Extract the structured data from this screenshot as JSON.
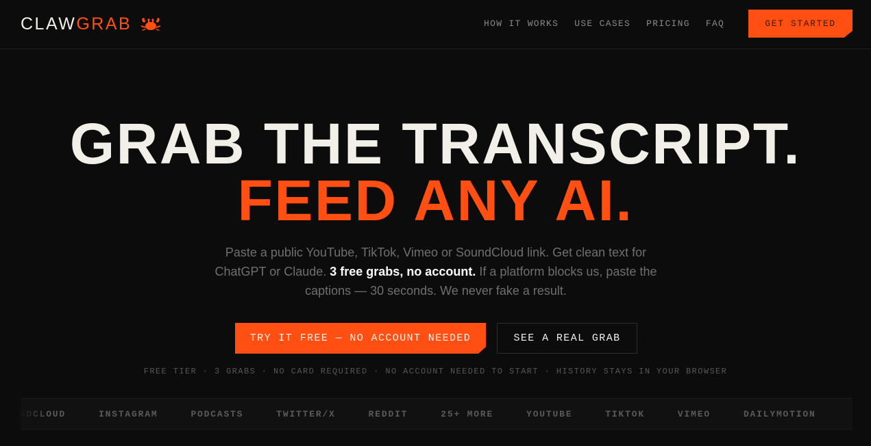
{
  "brand": {
    "name_white": "CLAW",
    "name_orange": "GRAB",
    "mascot_icon": "crab-icon",
    "accent_color": "#ff4f12"
  },
  "nav": {
    "links": [
      "HOW IT WORKS",
      "USE CASES",
      "PRICING",
      "FAQ"
    ],
    "cta": "GET STARTED"
  },
  "hero": {
    "headline_line1": "GRAB THE TRANSCRIPT.",
    "headline_line2": "FEED ANY AI.",
    "sub_part1": "Paste a public YouTube, TikTok, Vimeo or SoundCloud link. Get clean text for ChatGPT or Claude.",
    "sub_bold": "3 free grabs, no account.",
    "sub_part2": "If a platform blocks us, paste the captions — 30 seconds. We never fake a result.",
    "primary_button": "TRY IT FREE — NO ACCOUNT NEEDED",
    "secondary_button": "SEE A REAL GRAB",
    "meta_line": "FREE TIER · 3 GRABS · NO CARD REQUIRED · NO ACCOUNT NEEDED TO START · HISTORY STAYS IN YOUR BROWSER"
  },
  "ticker": {
    "items": [
      "SOUNDCLOUD",
      "INSTAGRAM",
      "PODCASTS",
      "TWITTER/X",
      "REDDIT",
      "25+ MORE",
      "YOUTUBE",
      "TIKTOK",
      "VIMEO",
      "DAILYMOTION"
    ]
  }
}
